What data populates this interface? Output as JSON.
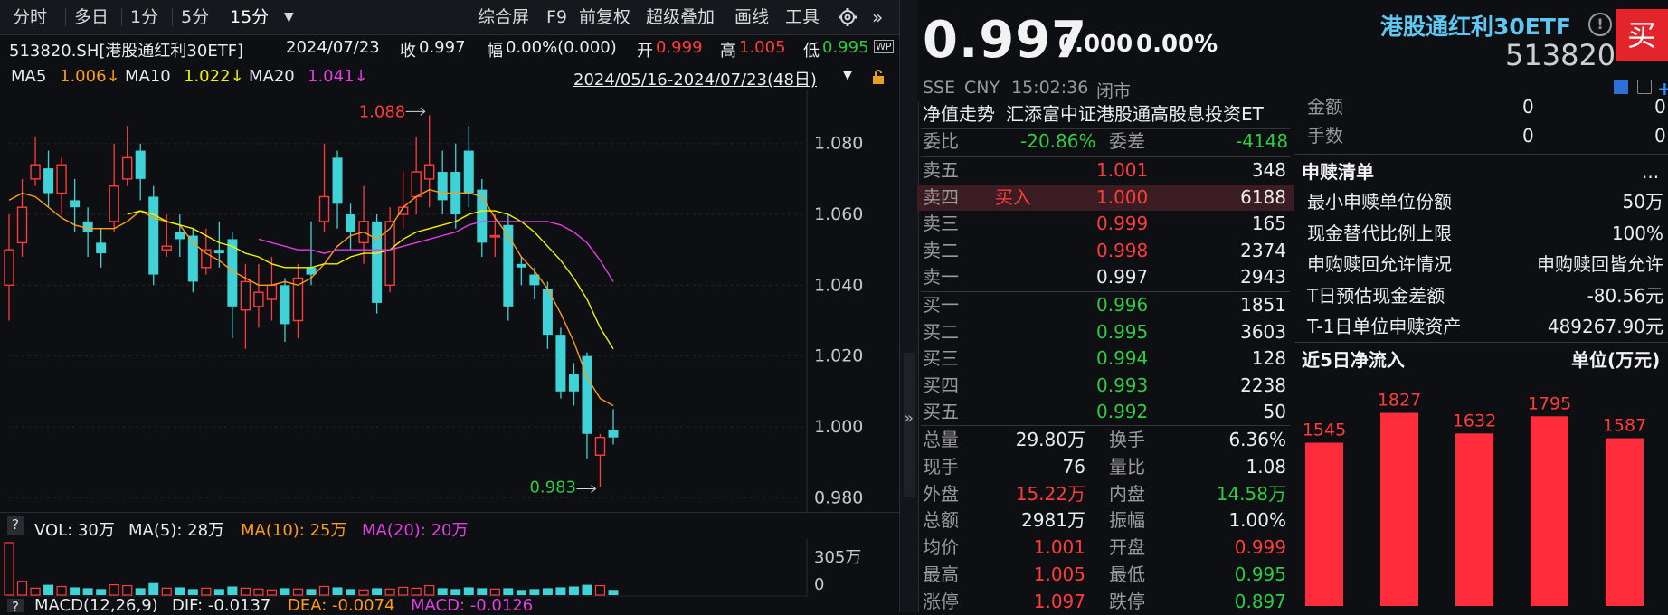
{
  "toolbar": {
    "tabs": [
      "分时",
      "多日",
      "1分",
      "5分",
      "15分"
    ],
    "dropdown_icon": "caret-down-icon",
    "right_items": [
      "综合屏",
      "F9",
      "前复权",
      "超级叠加",
      "画线",
      "工具"
    ],
    "gear_icon": "gear-icon",
    "more_icon": "double-chevron-right-icon"
  },
  "info": {
    "code": "513820.SH[港股通红利30ETF]",
    "date": "2024/07/23",
    "close_label": "收",
    "close": "0.997",
    "amp_label": "幅",
    "amp": "0.00%(0.000)",
    "open_label": "开",
    "open": "0.999",
    "high_label": "高",
    "high": "1.005",
    "low_label": "低",
    "low": "0.995",
    "wp_badge": "WP"
  },
  "ma": {
    "ma5_label": "MA5",
    "ma5": "1.006↓",
    "ma10_label": "MA10",
    "ma10": "1.022↓",
    "ma20_label": "MA20",
    "ma20": "1.041↓",
    "range": "2024/05/16-2024/07/23(48日)",
    "colors": {
      "ma5": "#ff9a1a",
      "ma10": "#f2f200",
      "ma20": "#e33de3"
    }
  },
  "chart_data": {
    "type": "candlestick",
    "yticks": [
      "1.080",
      "1.060",
      "1.040",
      "1.020",
      "1.000",
      "0.980"
    ],
    "ylim": [
      0.977,
      1.095
    ],
    "high_annotation": "1.088",
    "low_annotation": "0.983",
    "candles": [
      {
        "o": 1.04,
        "c": 1.05,
        "h": 1.06,
        "l": 1.03
      },
      {
        "o": 1.052,
        "c": 1.062,
        "h": 1.07,
        "l": 1.048
      },
      {
        "o": 1.07,
        "c": 1.074,
        "h": 1.082,
        "l": 1.068
      },
      {
        "o": 1.073,
        "c": 1.066,
        "h": 1.078,
        "l": 1.062
      },
      {
        "o": 1.066,
        "c": 1.074,
        "h": 1.076,
        "l": 1.06
      },
      {
        "o": 1.064,
        "c": 1.062,
        "h": 1.07,
        "l": 1.055
      },
      {
        "o": 1.058,
        "c": 1.055,
        "h": 1.062,
        "l": 1.048
      },
      {
        "o": 1.052,
        "c": 1.049,
        "h": 1.056,
        "l": 1.045
      },
      {
        "o": 1.058,
        "c": 1.068,
        "h": 1.08,
        "l": 1.055
      },
      {
        "o": 1.07,
        "c": 1.076,
        "h": 1.085,
        "l": 1.068
      },
      {
        "o": 1.078,
        "c": 1.07,
        "h": 1.08,
        "l": 1.064
      },
      {
        "o": 1.065,
        "c": 1.043,
        "h": 1.068,
        "l": 1.04
      },
      {
        "o": 1.05,
        "c": 1.051,
        "h": 1.06,
        "l": 1.048
      },
      {
        "o": 1.055,
        "c": 1.053,
        "h": 1.06,
        "l": 1.048
      },
      {
        "o": 1.054,
        "c": 1.041,
        "h": 1.056,
        "l": 1.038
      },
      {
        "o": 1.045,
        "c": 1.05,
        "h": 1.056,
        "l": 1.043
      },
      {
        "o": 1.05,
        "c": 1.049,
        "h": 1.058,
        "l": 1.045
      },
      {
        "o": 1.053,
        "c": 1.034,
        "h": 1.055,
        "l": 1.025
      },
      {
        "o": 1.033,
        "c": 1.041,
        "h": 1.046,
        "l": 1.022
      },
      {
        "o": 1.034,
        "c": 1.038,
        "h": 1.046,
        "l": 1.028
      },
      {
        "o": 1.036,
        "c": 1.04,
        "h": 1.048,
        "l": 1.03
      },
      {
        "o": 1.04,
        "c": 1.029,
        "h": 1.042,
        "l": 1.024
      },
      {
        "o": 1.03,
        "c": 1.042,
        "h": 1.046,
        "l": 1.025
      },
      {
        "o": 1.045,
        "c": 1.043,
        "h": 1.058,
        "l": 1.04
      },
      {
        "o": 1.058,
        "c": 1.065,
        "h": 1.08,
        "l": 1.055
      },
      {
        "o": 1.076,
        "c": 1.063,
        "h": 1.078,
        "l": 1.056
      },
      {
        "o": 1.06,
        "c": 1.055,
        "h": 1.063,
        "l": 1.05
      },
      {
        "o": 1.052,
        "c": 1.058,
        "h": 1.068,
        "l": 1.046
      },
      {
        "o": 1.058,
        "c": 1.035,
        "h": 1.06,
        "l": 1.032
      },
      {
        "o": 1.04,
        "c": 1.058,
        "h": 1.062,
        "l": 1.038
      },
      {
        "o": 1.06,
        "c": 1.062,
        "h": 1.072,
        "l": 1.056
      },
      {
        "o": 1.065,
        "c": 1.072,
        "h": 1.082,
        "l": 1.06
      },
      {
        "o": 1.07,
        "c": 1.074,
        "h": 1.088,
        "l": 1.062
      },
      {
        "o": 1.072,
        "c": 1.064,
        "h": 1.078,
        "l": 1.06
      },
      {
        "o": 1.072,
        "c": 1.06,
        "h": 1.08,
        "l": 1.056
      },
      {
        "o": 1.078,
        "c": 1.066,
        "h": 1.085,
        "l": 1.062
      },
      {
        "o": 1.067,
        "c": 1.052,
        "h": 1.07,
        "l": 1.048
      },
      {
        "o": 1.054,
        "c": 1.054,
        "h": 1.06,
        "l": 1.048
      },
      {
        "o": 1.057,
        "c": 1.034,
        "h": 1.06,
        "l": 1.03
      },
      {
        "o": 1.046,
        "c": 1.045,
        "h": 1.048,
        "l": 1.04
      },
      {
        "o": 1.043,
        "c": 1.04,
        "h": 1.045,
        "l": 1.036
      },
      {
        "o": 1.039,
        "c": 1.026,
        "h": 1.041,
        "l": 1.022
      },
      {
        "o": 1.026,
        "c": 1.01,
        "h": 1.028,
        "l": 1.008
      },
      {
        "o": 1.015,
        "c": 1.01,
        "h": 1.018,
        "l": 1.006
      },
      {
        "o": 1.02,
        "c": 0.998,
        "h": 1.021,
        "l": 0.991
      },
      {
        "o": 0.992,
        "c": 0.997,
        "h": 0.998,
        "l": 0.983
      },
      {
        "o": 0.999,
        "c": 0.997,
        "h": 1.005,
        "l": 0.995
      }
    ],
    "ma5": [
      1.064,
      1.066,
      1.065,
      1.062,
      1.059,
      1.057,
      1.056,
      1.056,
      1.056,
      1.058,
      1.061,
      1.059,
      1.058,
      1.057,
      1.052,
      1.049,
      1.047,
      1.044,
      1.042,
      1.04,
      1.04,
      1.041,
      1.04,
      1.042,
      1.046,
      1.051,
      1.054,
      1.055,
      1.053,
      1.056,
      1.062,
      1.065,
      1.067,
      1.066,
      1.066,
      1.066,
      1.065,
      1.059,
      1.054,
      1.048,
      1.044,
      1.039,
      1.032,
      1.024,
      1.014,
      1.008,
      1.006
    ],
    "ma10": [
      null,
      null,
      null,
      null,
      null,
      null,
      null,
      null,
      null,
      1.06,
      1.061,
      1.06,
      1.058,
      1.057,
      1.056,
      1.054,
      1.052,
      1.051,
      1.049,
      1.048,
      1.046,
      1.045,
      1.045,
      1.045,
      1.046,
      1.046,
      1.048,
      1.049,
      1.049,
      1.05,
      1.053,
      1.055,
      1.056,
      1.057,
      1.058,
      1.06,
      1.061,
      1.061,
      1.06,
      1.058,
      1.055,
      1.051,
      1.047,
      1.042,
      1.036,
      1.028,
      1.022
    ],
    "ma20": [
      null,
      null,
      null,
      null,
      null,
      null,
      null,
      null,
      null,
      null,
      null,
      null,
      null,
      null,
      null,
      null,
      null,
      null,
      null,
      1.053,
      1.052,
      1.051,
      1.05,
      1.05,
      1.049,
      1.05,
      1.05,
      1.05,
      1.05,
      1.05,
      1.051,
      1.052,
      1.053,
      1.054,
      1.055,
      1.057,
      1.058,
      1.058,
      1.058,
      1.058,
      1.058,
      1.058,
      1.057,
      1.055,
      1.052,
      1.047,
      1.041
    ]
  },
  "volume": {
    "label": "VOL: 30万",
    "ma5": "MA(5): 28万",
    "ma10": "MA(10): 25万",
    "ma20": "MA(20): 20万",
    "tick_high": "305万",
    "tick_low": "0",
    "bars": [
      305,
      80,
      40,
      60,
      50,
      45,
      40,
      35,
      60,
      55,
      40,
      70,
      40,
      45,
      35,
      40,
      35,
      50,
      40,
      35,
      30,
      40,
      35,
      35,
      50,
      45,
      35,
      30,
      40,
      35,
      45,
      40,
      55,
      40,
      35,
      45,
      40,
      35,
      40,
      30,
      35,
      40,
      45,
      50,
      60,
      55,
      30
    ]
  },
  "macd_bar": {
    "label": "MACD(12,26,9)",
    "dif": "DIF: -0.0137",
    "dea": "DEA: -0.0074",
    "macd": "MACD: -0.0126"
  },
  "quote": {
    "price": "0.997",
    "change": "0.000",
    "pct": "0.00%",
    "exchange": "SSE",
    "currency": "CNY",
    "time": "15:02:36",
    "status": "闭市",
    "name": "港股通红利30ETF",
    "code": "513820",
    "buy_button": "买",
    "info_icon": "info-icon"
  },
  "order_book": {
    "nav_label": "净值走势",
    "nav_desc": "汇添富中证港股通高股息投资ET",
    "wb_label": "委比",
    "wb": "-20.86%",
    "wc_label": "委差",
    "wc": "-4148",
    "asks": [
      {
        "label": "卖五",
        "tag": "",
        "price": "1.001",
        "vol": "348"
      },
      {
        "label": "卖四",
        "tag": "买入",
        "price": "1.000",
        "vol": "6188"
      },
      {
        "label": "卖三",
        "tag": "",
        "price": "0.999",
        "vol": "165"
      },
      {
        "label": "卖二",
        "tag": "",
        "price": "0.998",
        "vol": "2374"
      },
      {
        "label": "卖一",
        "tag": "",
        "price": "0.997",
        "vol": "2943"
      }
    ],
    "bids": [
      {
        "label": "买一",
        "price": "0.996",
        "vol": "1851"
      },
      {
        "label": "买二",
        "price": "0.995",
        "vol": "3603"
      },
      {
        "label": "买三",
        "price": "0.994",
        "vol": "128"
      },
      {
        "label": "买四",
        "price": "0.993",
        "vol": "2238"
      },
      {
        "label": "买五",
        "price": "0.992",
        "vol": "50"
      }
    ],
    "stats": [
      {
        "l1": "总量",
        "v1": "29.80万",
        "c1": "white",
        "l2": "换手",
        "v2": "6.36%",
        "c2": "white"
      },
      {
        "l1": "现手",
        "v1": "76",
        "c1": "white",
        "l2": "量比",
        "v2": "1.08",
        "c2": "white"
      },
      {
        "l1": "外盘",
        "v1": "15.22万",
        "c1": "red",
        "l2": "内盘",
        "v2": "14.58万",
        "c2": "green"
      },
      {
        "l1": "总额",
        "v1": "2981万",
        "c1": "white",
        "l2": "振幅",
        "v2": "1.00%",
        "c2": "white"
      },
      {
        "l1": "均价",
        "v1": "1.001",
        "c1": "red",
        "l2": "开盘",
        "v2": "0.999",
        "c2": "red"
      },
      {
        "l1": "最高",
        "v1": "1.005",
        "c1": "red",
        "l2": "最低",
        "v2": "0.995",
        "c2": "green"
      },
      {
        "l1": "涨停",
        "v1": "1.097",
        "c1": "red",
        "l2": "跌停",
        "v2": "0.897",
        "c2": "green"
      }
    ]
  },
  "right": {
    "top_rows": [
      {
        "label": "金额",
        "v1": "0",
        "v2": "0"
      },
      {
        "label": "手数",
        "v1": "0",
        "v2": "0"
      }
    ],
    "section_title": "申赎清单",
    "section_more": "...",
    "rows": [
      {
        "label": "最小申赎单位份额",
        "value": "50万"
      },
      {
        "label": "现金替代比例上限",
        "value": "100%"
      },
      {
        "label": "申购赎回允许情况",
        "value": "申购赎回皆允许"
      },
      {
        "label": "T日预估现金差额",
        "value": "-80.56元"
      },
      {
        "label": "T-1日单位申赎资产",
        "value": "489267.90元"
      }
    ],
    "flow_title": "近5日净流入",
    "flow_unit": "单位(万元)"
  },
  "flow_chart": {
    "type": "bar",
    "values": [
      1545,
      1827,
      1632,
      1795,
      1587
    ],
    "bar_color": "#ff2d3c"
  }
}
